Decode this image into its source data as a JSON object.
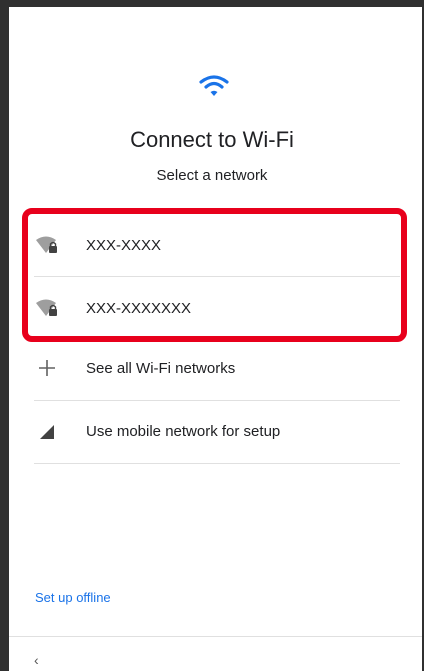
{
  "header": {
    "icon": "wifi-icon",
    "title": "Connect to Wi-Fi",
    "subtitle": "Select a network"
  },
  "networks": [
    {
      "name": "XXX-XXXX",
      "icon": "wifi-lock-icon"
    },
    {
      "name": "XXX-XXXXXXX",
      "icon": "wifi-lock-icon"
    }
  ],
  "options": [
    {
      "label": "See all Wi-Fi networks",
      "icon": "plus-icon"
    },
    {
      "label": "Use mobile network for setup",
      "icon": "cellular-signal-icon"
    }
  ],
  "footer": {
    "setup_offline": "Set up offline",
    "back_glyph": "‹"
  },
  "colors": {
    "accent": "#1a73e8",
    "highlight": "#e8001c",
    "text": "#202124"
  }
}
